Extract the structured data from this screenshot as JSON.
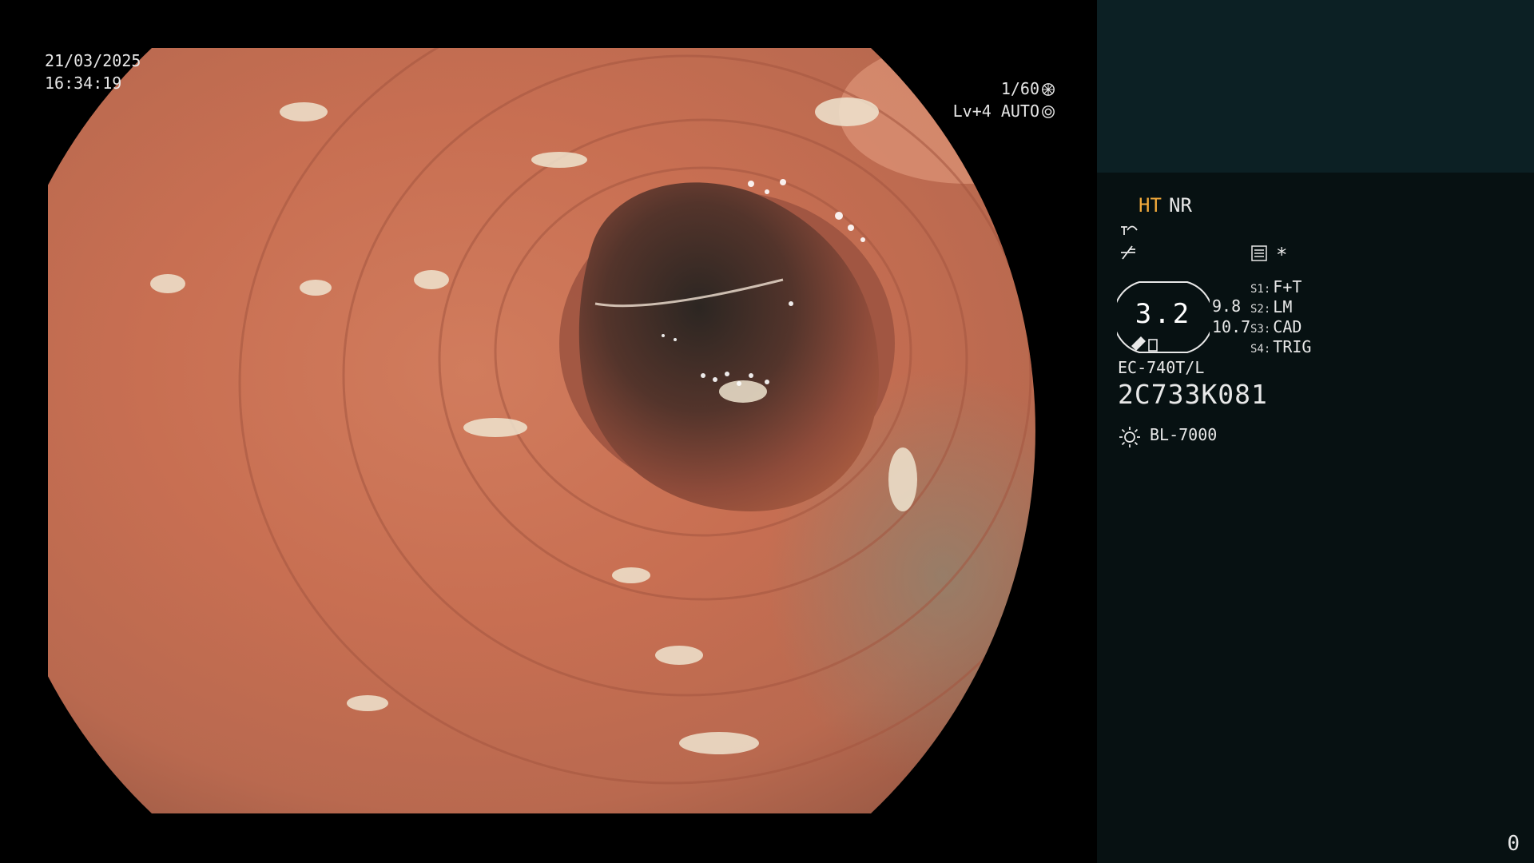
{
  "osd": {
    "date": "21/03/2025",
    "time": "16:34:19",
    "shutter": "1/60",
    "level": "Lv+4 AUTO"
  },
  "panel": {
    "ht": "HT",
    "nr": "NR",
    "asterisk": "*",
    "zoom": "3.2",
    "value_a": "9.8",
    "value_b": "10.7",
    "switches": [
      {
        "key": "S1:",
        "value": "F+T"
      },
      {
        "key": "S2:",
        "value": "LM"
      },
      {
        "key": "S3:",
        "value": "CAD"
      },
      {
        "key": "S4:",
        "value": "TRIG"
      }
    ],
    "scope_model": "EC-740T/L",
    "serial": "2C733K081",
    "light_source": "BL-7000"
  },
  "frame_count": "0",
  "icons": [
    "shutter-icon",
    "auto-iris-icon",
    "fx-curve-icon",
    "fx-slash-icon",
    "memo-icon",
    "scope-tip-icon",
    "light-icon"
  ],
  "colors": {
    "ht": "#f2a93b",
    "panel_bg": "#071112",
    "panel_top": "#0c2024"
  }
}
